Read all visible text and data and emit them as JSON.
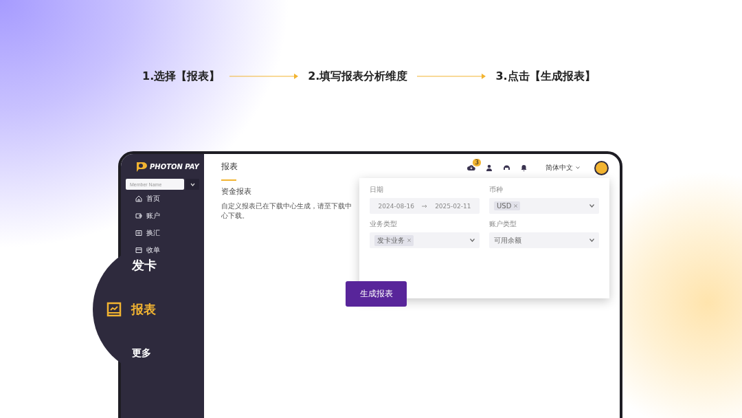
{
  "steps": [
    {
      "label": "1.选择【报表】"
    },
    {
      "label": "2.填写报表分析维度"
    },
    {
      "label": "3.点击【生成报表】"
    }
  ],
  "sidebar": {
    "logo": "PHOTON PAY",
    "member_select": {
      "placeholder": "Member Name"
    },
    "items": [
      {
        "label": "首页",
        "kind": "home",
        "selected": false
      },
      {
        "label": "账户",
        "kind": "wallet",
        "selected": false
      },
      {
        "label": "换汇",
        "kind": "exchange",
        "selected": false
      },
      {
        "label": "收单",
        "kind": "receipt",
        "selected": false
      }
    ]
  },
  "header": {
    "download_badge": "3",
    "language": "简体中文"
  },
  "page": {
    "title": "报表",
    "subtitle": "资金报表",
    "notice": "自定义报表已在下载中心生成，请至下载中心下载。"
  },
  "form": {
    "fields": [
      {
        "kind": "daterange",
        "label": "日期",
        "start": "2024-08-16",
        "end": "2025-02-11"
      },
      {
        "kind": "select",
        "label": "币种",
        "tags": [
          "USD"
        ]
      },
      {
        "kind": "select",
        "label": "业务类型",
        "tags": [
          "发卡业务"
        ]
      },
      {
        "kind": "select",
        "label": "账户类型",
        "value": "可用余额"
      }
    ]
  },
  "generate_button": "生成报表",
  "magnifier": {
    "items": [
      {
        "label": "发卡",
        "selected": false
      },
      {
        "label": "报表",
        "selected": true
      },
      {
        "label": "更多",
        "selected": false
      }
    ]
  }
}
